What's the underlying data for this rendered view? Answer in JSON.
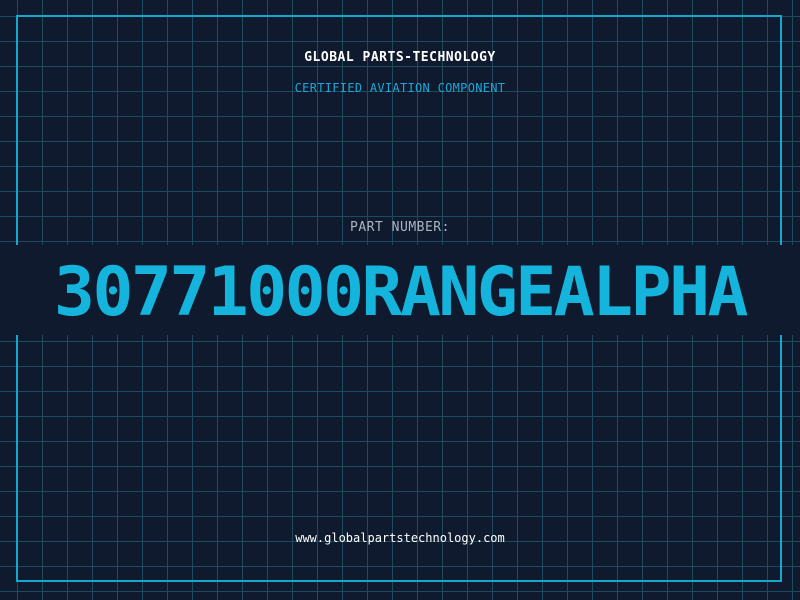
{
  "header": {
    "title": "GLOBAL PARTS-TECHNOLOGY",
    "subtitle": "CERTIFIED AVIATION COMPONENT"
  },
  "part": {
    "label": "PART NUMBER:",
    "number": "30771000RANGEALPHA"
  },
  "footer": {
    "url": "www.globalpartstechnology.com"
  },
  "colors": {
    "background": "#0f1a2e",
    "grid": "#1e4a5e",
    "accent": "#14b4dc",
    "frame": "#14a8cc"
  }
}
